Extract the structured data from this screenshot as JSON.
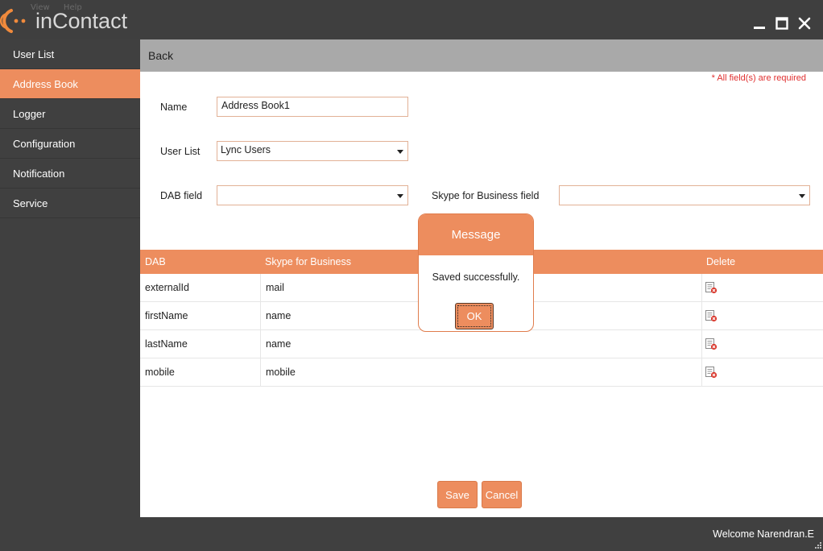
{
  "app": {
    "logo_text": "inContact",
    "ghost_menu": [
      "View",
      "Help"
    ]
  },
  "window": {
    "minimize_icon": "minimize-icon",
    "maximize_icon": "maximize-icon",
    "close_icon": "close-icon"
  },
  "sidebar": {
    "items": [
      {
        "label": "User List",
        "active": false
      },
      {
        "label": "Address Book",
        "active": true
      },
      {
        "label": "Logger",
        "active": false
      },
      {
        "label": "Configuration",
        "active": false
      },
      {
        "label": "Notification",
        "active": false
      },
      {
        "label": "Service",
        "active": false
      }
    ]
  },
  "header": {
    "back_label": "Back",
    "required_note": "* All field(s) are required"
  },
  "form": {
    "name_label": "Name",
    "name_value": "Address Book1",
    "user_list_label": "User List",
    "user_list_value": "Lync Users",
    "dab_field_label": "DAB field",
    "dab_field_value": "",
    "skype_field_label": "Skype for Business field",
    "skype_field_value": ""
  },
  "table": {
    "columns": [
      "DAB",
      "Skype for Business",
      "Delete"
    ],
    "rows": [
      {
        "dab": "externalId",
        "skype": "mail"
      },
      {
        "dab": "firstName",
        "skype": "name"
      },
      {
        "dab": "lastName",
        "skype": "name"
      },
      {
        "dab": "mobile",
        "skype": "mobile"
      }
    ]
  },
  "actions": {
    "save_label": "Save",
    "cancel_label": "Cancel"
  },
  "dialog": {
    "title": "Message",
    "message": "Saved successfully.",
    "ok_label": "OK"
  },
  "status": {
    "welcome_label": "Welcome",
    "user_name": "Narendran.E"
  },
  "colors": {
    "accent": "#ed8d5e",
    "dark": "#404040",
    "required": "#e03030"
  }
}
